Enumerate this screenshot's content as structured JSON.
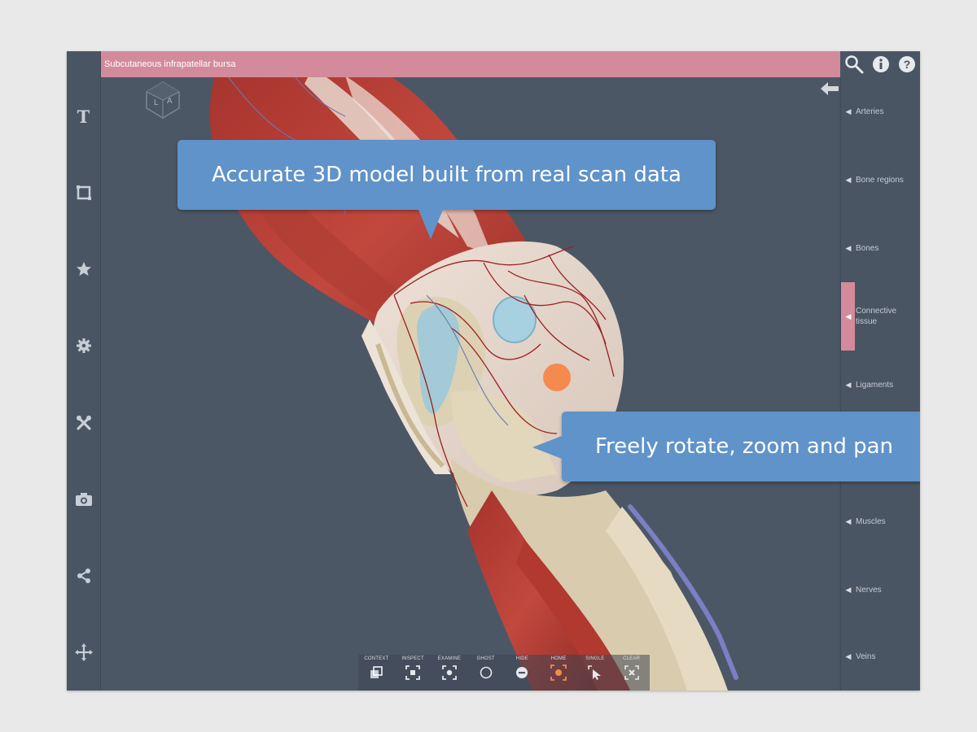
{
  "title_bar": {
    "text": "Subcutaneous infrapatellar bursa"
  },
  "left_toolbar": {
    "items": [
      {
        "name": "text-tool",
        "icon": "text-icon"
      },
      {
        "name": "crop-tool",
        "icon": "crop-icon"
      },
      {
        "name": "favorites-tool",
        "icon": "star-icon"
      },
      {
        "name": "settings-tool",
        "icon": "gear-icon"
      },
      {
        "name": "tools-tool",
        "icon": "tools-icon"
      },
      {
        "name": "camera-tool",
        "icon": "camera-icon"
      },
      {
        "name": "share-tool",
        "icon": "share-icon"
      },
      {
        "name": "move-tool",
        "icon": "move-icon"
      }
    ]
  },
  "top_right": {
    "icons": [
      "search-icon",
      "info-icon",
      "help-icon"
    ]
  },
  "orientation_cube": {
    "labels": [
      "L",
      "A"
    ]
  },
  "right_panel": {
    "categories": [
      {
        "label": "Arteries",
        "active": false
      },
      {
        "label": "Bone regions",
        "active": false
      },
      {
        "label": "Bones",
        "active": false
      },
      {
        "label": "Connective tissue",
        "active": true
      },
      {
        "label": "Ligaments",
        "active": false
      },
      {
        "label": "",
        "active": false
      },
      {
        "label": "Muscles",
        "active": false
      },
      {
        "label": "Nerves",
        "active": false
      },
      {
        "label": "Veins",
        "active": false
      }
    ]
  },
  "callouts": {
    "first": "Accurate 3D model built from real scan data",
    "second": "Freely rotate, zoom and pan"
  },
  "bottom_toolbar": {
    "items": [
      {
        "label": "CONTEXT",
        "icon": "context-icon"
      },
      {
        "label": "INSPECT",
        "icon": "inspect-icon"
      },
      {
        "label": "EXAMINE",
        "icon": "examine-icon"
      },
      {
        "label": "GHOST",
        "icon": "ghost-icon"
      },
      {
        "label": "HIDE",
        "icon": "hide-icon"
      },
      {
        "label": "HOME",
        "icon": "home-icon"
      },
      {
        "label": "SINGLE",
        "icon": "single-select-icon"
      },
      {
        "label": "CLEAR",
        "icon": "clear-icon"
      }
    ]
  },
  "colors": {
    "accent_pink": "#d38b9b",
    "callout_blue": "#5f93c9",
    "panel_bg": "#4a5564",
    "viewport_bg": "#4c5766",
    "selected_orange": "#f58a4f"
  }
}
